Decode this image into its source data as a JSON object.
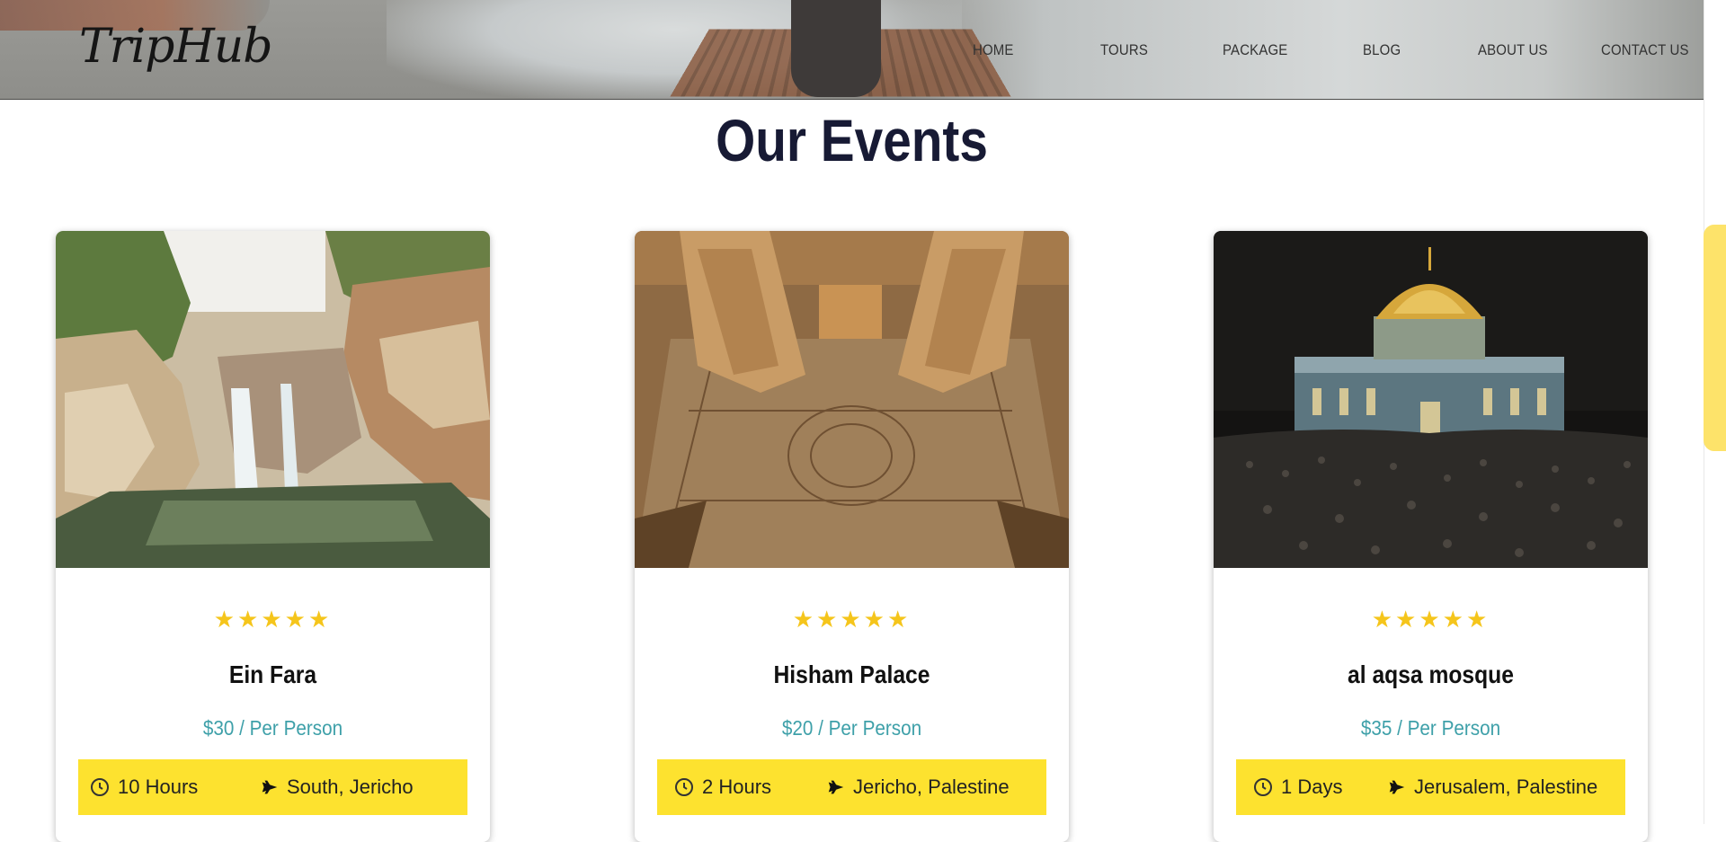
{
  "header": {
    "logo": "TripHub",
    "nav": [
      {
        "label": "HOME"
      },
      {
        "label": "TOURS"
      },
      {
        "label": "PACKAGE"
      },
      {
        "label": "BLOG"
      },
      {
        "label": "ABOUT US"
      },
      {
        "label": "CONTACT US"
      }
    ]
  },
  "section": {
    "title": "Our Events"
  },
  "events": [
    {
      "rating": 5,
      "stars": "★★★★★",
      "title": "Ein Fara",
      "price": "$30 / Per Person",
      "duration": "10 Hours",
      "location": "South, Jericho",
      "image": "waterfall-canyon"
    },
    {
      "rating": 5,
      "stars": "★★★★★",
      "title": "Hisham Palace",
      "price": "$20 / Per Person",
      "duration": "2 Hours",
      "location": "Jericho, Palestine",
      "image": "mosaic-floor-ruins"
    },
    {
      "rating": 5,
      "stars": "★★★★★",
      "title": "al aqsa mosque",
      "price": "$35 / Per Person",
      "duration": "1 Days",
      "location": "Jerusalem, Palestine",
      "image": "dome-of-the-rock-night"
    }
  ],
  "colors": {
    "accent_yellow": "#fde22f",
    "star": "#f5c51b",
    "price": "#3ea0a9",
    "title_dark": "#171a34"
  }
}
